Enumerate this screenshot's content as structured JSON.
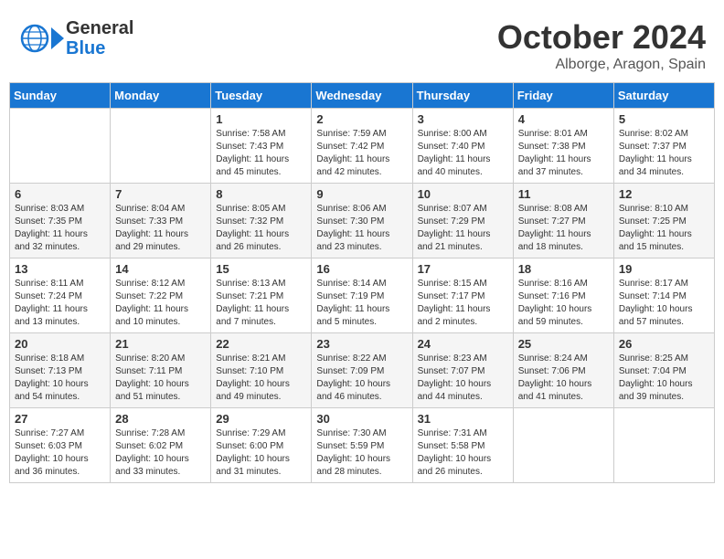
{
  "header": {
    "logo_line1": "General",
    "logo_line2": "Blue",
    "month": "October 2024",
    "location": "Alborge, Aragon, Spain"
  },
  "days_of_week": [
    "Sunday",
    "Monday",
    "Tuesday",
    "Wednesday",
    "Thursday",
    "Friday",
    "Saturday"
  ],
  "weeks": [
    [
      {
        "day": "",
        "sunrise": "",
        "sunset": "",
        "daylight": ""
      },
      {
        "day": "",
        "sunrise": "",
        "sunset": "",
        "daylight": ""
      },
      {
        "day": "1",
        "sunrise": "Sunrise: 7:58 AM",
        "sunset": "Sunset: 7:43 PM",
        "daylight": "Daylight: 11 hours and 45 minutes."
      },
      {
        "day": "2",
        "sunrise": "Sunrise: 7:59 AM",
        "sunset": "Sunset: 7:42 PM",
        "daylight": "Daylight: 11 hours and 42 minutes."
      },
      {
        "day": "3",
        "sunrise": "Sunrise: 8:00 AM",
        "sunset": "Sunset: 7:40 PM",
        "daylight": "Daylight: 11 hours and 40 minutes."
      },
      {
        "day": "4",
        "sunrise": "Sunrise: 8:01 AM",
        "sunset": "Sunset: 7:38 PM",
        "daylight": "Daylight: 11 hours and 37 minutes."
      },
      {
        "day": "5",
        "sunrise": "Sunrise: 8:02 AM",
        "sunset": "Sunset: 7:37 PM",
        "daylight": "Daylight: 11 hours and 34 minutes."
      }
    ],
    [
      {
        "day": "6",
        "sunrise": "Sunrise: 8:03 AM",
        "sunset": "Sunset: 7:35 PM",
        "daylight": "Daylight: 11 hours and 32 minutes."
      },
      {
        "day": "7",
        "sunrise": "Sunrise: 8:04 AM",
        "sunset": "Sunset: 7:33 PM",
        "daylight": "Daylight: 11 hours and 29 minutes."
      },
      {
        "day": "8",
        "sunrise": "Sunrise: 8:05 AM",
        "sunset": "Sunset: 7:32 PM",
        "daylight": "Daylight: 11 hours and 26 minutes."
      },
      {
        "day": "9",
        "sunrise": "Sunrise: 8:06 AM",
        "sunset": "Sunset: 7:30 PM",
        "daylight": "Daylight: 11 hours and 23 minutes."
      },
      {
        "day": "10",
        "sunrise": "Sunrise: 8:07 AM",
        "sunset": "Sunset: 7:29 PM",
        "daylight": "Daylight: 11 hours and 21 minutes."
      },
      {
        "day": "11",
        "sunrise": "Sunrise: 8:08 AM",
        "sunset": "Sunset: 7:27 PM",
        "daylight": "Daylight: 11 hours and 18 minutes."
      },
      {
        "day": "12",
        "sunrise": "Sunrise: 8:10 AM",
        "sunset": "Sunset: 7:25 PM",
        "daylight": "Daylight: 11 hours and 15 minutes."
      }
    ],
    [
      {
        "day": "13",
        "sunrise": "Sunrise: 8:11 AM",
        "sunset": "Sunset: 7:24 PM",
        "daylight": "Daylight: 11 hours and 13 minutes."
      },
      {
        "day": "14",
        "sunrise": "Sunrise: 8:12 AM",
        "sunset": "Sunset: 7:22 PM",
        "daylight": "Daylight: 11 hours and 10 minutes."
      },
      {
        "day": "15",
        "sunrise": "Sunrise: 8:13 AM",
        "sunset": "Sunset: 7:21 PM",
        "daylight": "Daylight: 11 hours and 7 minutes."
      },
      {
        "day": "16",
        "sunrise": "Sunrise: 8:14 AM",
        "sunset": "Sunset: 7:19 PM",
        "daylight": "Daylight: 11 hours and 5 minutes."
      },
      {
        "day": "17",
        "sunrise": "Sunrise: 8:15 AM",
        "sunset": "Sunset: 7:17 PM",
        "daylight": "Daylight: 11 hours and 2 minutes."
      },
      {
        "day": "18",
        "sunrise": "Sunrise: 8:16 AM",
        "sunset": "Sunset: 7:16 PM",
        "daylight": "Daylight: 10 hours and 59 minutes."
      },
      {
        "day": "19",
        "sunrise": "Sunrise: 8:17 AM",
        "sunset": "Sunset: 7:14 PM",
        "daylight": "Daylight: 10 hours and 57 minutes."
      }
    ],
    [
      {
        "day": "20",
        "sunrise": "Sunrise: 8:18 AM",
        "sunset": "Sunset: 7:13 PM",
        "daylight": "Daylight: 10 hours and 54 minutes."
      },
      {
        "day": "21",
        "sunrise": "Sunrise: 8:20 AM",
        "sunset": "Sunset: 7:11 PM",
        "daylight": "Daylight: 10 hours and 51 minutes."
      },
      {
        "day": "22",
        "sunrise": "Sunrise: 8:21 AM",
        "sunset": "Sunset: 7:10 PM",
        "daylight": "Daylight: 10 hours and 49 minutes."
      },
      {
        "day": "23",
        "sunrise": "Sunrise: 8:22 AM",
        "sunset": "Sunset: 7:09 PM",
        "daylight": "Daylight: 10 hours and 46 minutes."
      },
      {
        "day": "24",
        "sunrise": "Sunrise: 8:23 AM",
        "sunset": "Sunset: 7:07 PM",
        "daylight": "Daylight: 10 hours and 44 minutes."
      },
      {
        "day": "25",
        "sunrise": "Sunrise: 8:24 AM",
        "sunset": "Sunset: 7:06 PM",
        "daylight": "Daylight: 10 hours and 41 minutes."
      },
      {
        "day": "26",
        "sunrise": "Sunrise: 8:25 AM",
        "sunset": "Sunset: 7:04 PM",
        "daylight": "Daylight: 10 hours and 39 minutes."
      }
    ],
    [
      {
        "day": "27",
        "sunrise": "Sunrise: 7:27 AM",
        "sunset": "Sunset: 6:03 PM",
        "daylight": "Daylight: 10 hours and 36 minutes."
      },
      {
        "day": "28",
        "sunrise": "Sunrise: 7:28 AM",
        "sunset": "Sunset: 6:02 PM",
        "daylight": "Daylight: 10 hours and 33 minutes."
      },
      {
        "day": "29",
        "sunrise": "Sunrise: 7:29 AM",
        "sunset": "Sunset: 6:00 PM",
        "daylight": "Daylight: 10 hours and 31 minutes."
      },
      {
        "day": "30",
        "sunrise": "Sunrise: 7:30 AM",
        "sunset": "Sunset: 5:59 PM",
        "daylight": "Daylight: 10 hours and 28 minutes."
      },
      {
        "day": "31",
        "sunrise": "Sunrise: 7:31 AM",
        "sunset": "Sunset: 5:58 PM",
        "daylight": "Daylight: 10 hours and 26 minutes."
      },
      {
        "day": "",
        "sunrise": "",
        "sunset": "",
        "daylight": ""
      },
      {
        "day": "",
        "sunrise": "",
        "sunset": "",
        "daylight": ""
      }
    ]
  ]
}
